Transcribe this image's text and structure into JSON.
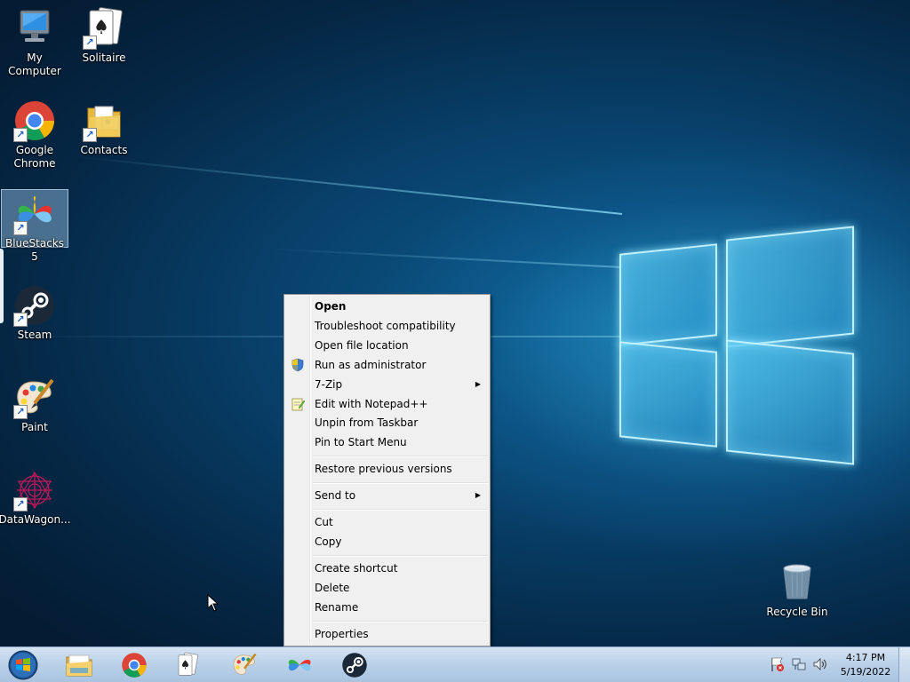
{
  "desktop": {
    "icons": [
      {
        "label": "My Computer",
        "icon": "computer-icon"
      },
      {
        "label": "Solitaire",
        "icon": "solitaire-icon"
      },
      {
        "label": "Google Chrome",
        "icon": "chrome-icon"
      },
      {
        "label": "Contacts",
        "icon": "contacts-folder-icon"
      },
      {
        "label": "BlueStacks 5",
        "icon": "bluestacks-icon"
      },
      {
        "label": "Steam",
        "icon": "steam-icon"
      },
      {
        "label": "Paint",
        "icon": "paint-icon"
      },
      {
        "label": "DataWagon...",
        "icon": "datawagon-icon"
      },
      {
        "label": "Recycle Bin",
        "icon": "recycle-bin-icon"
      }
    ]
  },
  "context_menu": {
    "items": [
      {
        "label": "Open",
        "bold": true
      },
      {
        "label": "Troubleshoot compatibility"
      },
      {
        "label": "Open file location"
      },
      {
        "label": "Run as administrator",
        "icon": "uac-shield-icon"
      },
      {
        "label": "7-Zip",
        "submenu": true
      },
      {
        "label": "Edit with Notepad++",
        "icon": "notepad-plus-icon"
      },
      {
        "label": "Unpin from Taskbar"
      },
      {
        "label": "Pin to Start Menu"
      },
      {
        "label": "Restore previous versions"
      },
      {
        "label": "Send to",
        "submenu": true
      },
      {
        "label": "Cut"
      },
      {
        "label": "Copy"
      },
      {
        "label": "Create shortcut"
      },
      {
        "label": "Delete"
      },
      {
        "label": "Rename"
      },
      {
        "label": "Properties"
      }
    ]
  },
  "taskbar": {
    "clock_time": "4:17 PM",
    "clock_date": "5/19/2022",
    "pinned": [
      "file-explorer-icon",
      "chrome-icon",
      "solitaire-icon",
      "paint-icon",
      "bluestacks-icon",
      "steam-icon"
    ]
  },
  "colors": {
    "menu_bg": "#f0f0f0",
    "taskbar": "#bcd2e9",
    "wallpaper_dark": "#052846",
    "wallpaper_light": "#3cbeeb"
  }
}
